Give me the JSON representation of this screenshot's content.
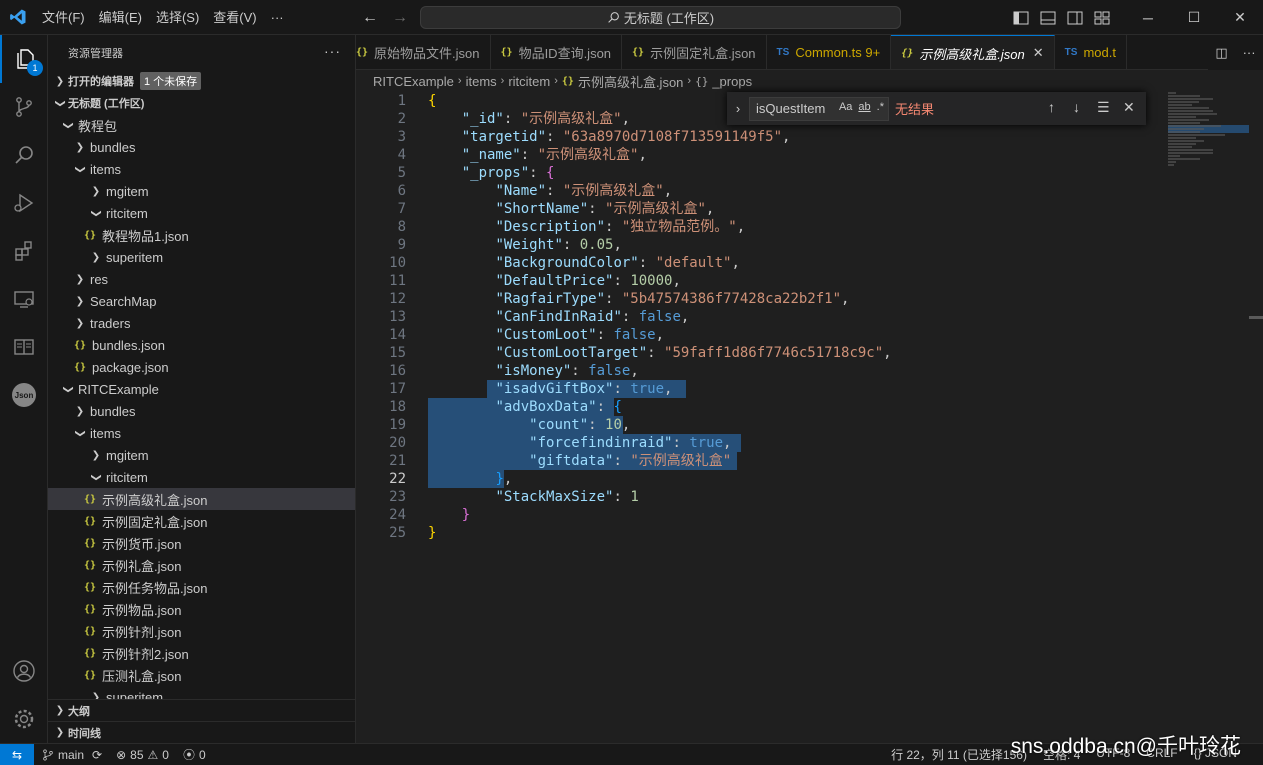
{
  "titlebar": {
    "menu": [
      "文件(F)",
      "编辑(E)",
      "选择(S)",
      "查看(V)",
      "···"
    ],
    "search": "无标题 (工作区)"
  },
  "activity": {
    "explorer_badge": "1"
  },
  "sidebar": {
    "title": "资源管理器",
    "open_editors": "打开的编辑器",
    "unsaved": "1 个未保存",
    "workspace": "无标题 (工作区)",
    "tree": [
      {
        "label": "教程包",
        "depth": 1,
        "type": "folder-open"
      },
      {
        "label": "bundles",
        "depth": 2,
        "type": "folder"
      },
      {
        "label": "items",
        "depth": 2,
        "type": "folder-open"
      },
      {
        "label": "mgitem",
        "depth": 3,
        "type": "folder"
      },
      {
        "label": "ritcitem",
        "depth": 3,
        "type": "folder-open"
      },
      {
        "label": "教程物品1.json",
        "depth": 4,
        "type": "json"
      },
      {
        "label": "superitem",
        "depth": 3,
        "type": "folder"
      },
      {
        "label": "res",
        "depth": 2,
        "type": "folder"
      },
      {
        "label": "SearchMap",
        "depth": 2,
        "type": "folder"
      },
      {
        "label": "traders",
        "depth": 2,
        "type": "folder"
      },
      {
        "label": "bundles.json",
        "depth": 2,
        "type": "json"
      },
      {
        "label": "package.json",
        "depth": 2,
        "type": "json"
      },
      {
        "label": "RITCExample",
        "depth": 1,
        "type": "folder-open"
      },
      {
        "label": "bundles",
        "depth": 2,
        "type": "folder"
      },
      {
        "label": "items",
        "depth": 2,
        "type": "folder-open"
      },
      {
        "label": "mgitem",
        "depth": 3,
        "type": "folder"
      },
      {
        "label": "ritcitem",
        "depth": 3,
        "type": "folder-open"
      },
      {
        "label": "示例高级礼盒.json",
        "depth": 4,
        "type": "json",
        "selected": true
      },
      {
        "label": "示例固定礼盒.json",
        "depth": 4,
        "type": "json"
      },
      {
        "label": "示例货币.json",
        "depth": 4,
        "type": "json"
      },
      {
        "label": "示例礼盒.json",
        "depth": 4,
        "type": "json"
      },
      {
        "label": "示例任务物品.json",
        "depth": 4,
        "type": "json"
      },
      {
        "label": "示例物品.json",
        "depth": 4,
        "type": "json"
      },
      {
        "label": "示例针剂.json",
        "depth": 4,
        "type": "json"
      },
      {
        "label": "示例针剂2.json",
        "depth": 4,
        "type": "json"
      },
      {
        "label": "压测礼盒.json",
        "depth": 4,
        "type": "json"
      },
      {
        "label": "superitem",
        "depth": 3,
        "type": "folder"
      }
    ],
    "outline": "大纲",
    "timeline": "时间线"
  },
  "tabs": [
    {
      "label": "原始物品文件.json",
      "kind": "json"
    },
    {
      "label": "物品ID查询.json",
      "kind": "json"
    },
    {
      "label": "示例固定礼盒.json",
      "kind": "json"
    },
    {
      "label": "Common.ts 9+",
      "kind": "ts",
      "warn": true
    },
    {
      "label": "示例高级礼盒.json",
      "kind": "json",
      "active": true
    },
    {
      "label": "mod.t",
      "kind": "ts",
      "warn": true
    }
  ],
  "breadcrumb": [
    "RITCExample",
    "items",
    "ritcitem",
    "示例高级礼盒.json",
    "_props"
  ],
  "find": {
    "query": "isQuestItem",
    "opt_case": "Aa",
    "opt_word": "ab",
    "opt_regex": ".*",
    "result": "无结果"
  },
  "editor": {
    "current_line": 22
  },
  "status": {
    "branch": "main",
    "errors": "85",
    "warnings": "0",
    "ports": "0",
    "position": "行 22，列 11 (已选择156)",
    "spaces": "空格: 4",
    "encoding": "UTF-8",
    "eol": "CRLF",
    "lang": "{} JSON"
  },
  "watermark": "sns.oddba.cn@千叶玲花"
}
